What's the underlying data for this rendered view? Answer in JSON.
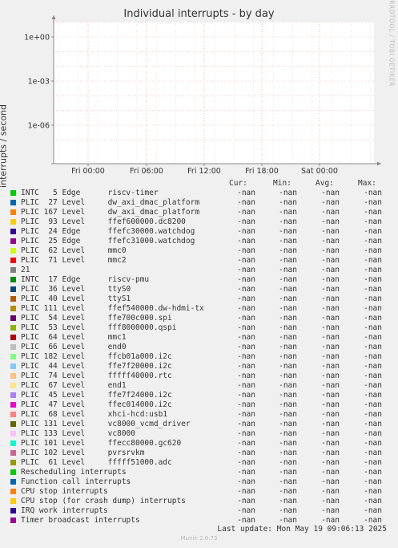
{
  "chart_data": {
    "type": "line",
    "title": "Individual interrupts - by day",
    "ylabel": "interrupts / second",
    "yscale": "log",
    "yticks": [
      "1e+00",
      "1e-03",
      "1e-06"
    ],
    "xticks": [
      "Fri 00:00",
      "Fri 06:00",
      "Fri 12:00",
      "Fri 18:00",
      "Sat 00:00"
    ],
    "grid": true,
    "watermark": "RRDTOOL / TOBI OETIKER",
    "columns": [
      "Cur:",
      "Min:",
      "Avg:",
      "Max:"
    ],
    "series": [
      {
        "name": "INTC   5 Edge      riscv-timer",
        "color": "#00cc00",
        "cur": "-nan",
        "min": "-nan",
        "avg": "-nan",
        "max": "-nan"
      },
      {
        "name": "PLIC  27 Level     dw_axi_dmac_platform",
        "color": "#0066b3",
        "cur": "-nan",
        "min": "-nan",
        "avg": "-nan",
        "max": "-nan"
      },
      {
        "name": "PLIC 167 Level     dw_axi_dmac_platform",
        "color": "#ff8000",
        "cur": "-nan",
        "min": "-nan",
        "avg": "-nan",
        "max": "-nan"
      },
      {
        "name": "PLIC  93 Level     ffef600000.dc8200",
        "color": "#ffcc00",
        "cur": "-nan",
        "min": "-nan",
        "avg": "-nan",
        "max": "-nan"
      },
      {
        "name": "PLIC  24 Edge      ffefc30000.watchdog",
        "color": "#330099",
        "cur": "-nan",
        "min": "-nan",
        "avg": "-nan",
        "max": "-nan"
      },
      {
        "name": "PLIC  25 Edge      ffefc31000.watchdog",
        "color": "#990099",
        "cur": "-nan",
        "min": "-nan",
        "avg": "-nan",
        "max": "-nan"
      },
      {
        "name": "PLIC  62 Level     mmc0",
        "color": "#ccff00",
        "cur": "-nan",
        "min": "-nan",
        "avg": "-nan",
        "max": "-nan"
      },
      {
        "name": "PLIC  71 Level     mmc2",
        "color": "#ff0000",
        "cur": "-nan",
        "min": "-nan",
        "avg": "-nan",
        "max": "-nan"
      },
      {
        "name": "21",
        "color": "#808080",
        "cur": "-nan",
        "min": "-nan",
        "avg": "-nan",
        "max": "-nan"
      },
      {
        "name": "INTC  17 Edge      riscv-pmu",
        "color": "#008f00",
        "cur": "-nan",
        "min": "-nan",
        "avg": "-nan",
        "max": "-nan"
      },
      {
        "name": "PLIC  36 Level     ttyS0",
        "color": "#00487d",
        "cur": "-nan",
        "min": "-nan",
        "avg": "-nan",
        "max": "-nan"
      },
      {
        "name": "PLIC  40 Level     ttyS1",
        "color": "#b35a00",
        "cur": "-nan",
        "min": "-nan",
        "avg": "-nan",
        "max": "-nan"
      },
      {
        "name": "PLIC 111 Level     ffef540000.dw-hdmi-tx",
        "color": "#b38f00",
        "cur": "-nan",
        "min": "-nan",
        "avg": "-nan",
        "max": "-nan"
      },
      {
        "name": "PLIC  54 Level     ffe700c000.spi",
        "color": "#6b006b",
        "cur": "-nan",
        "min": "-nan",
        "avg": "-nan",
        "max": "-nan"
      },
      {
        "name": "PLIC  53 Level     fff8000000.qspi",
        "color": "#8fb300",
        "cur": "-nan",
        "min": "-nan",
        "avg": "-nan",
        "max": "-nan"
      },
      {
        "name": "PLIC  64 Level     mmc1",
        "color": "#b30000",
        "cur": "-nan",
        "min": "-nan",
        "avg": "-nan",
        "max": "-nan"
      },
      {
        "name": "PLIC  66 Level     end0",
        "color": "#bebebe",
        "cur": "-nan",
        "min": "-nan",
        "avg": "-nan",
        "max": "-nan"
      },
      {
        "name": "PLIC 182 Level     ffcb01a000.i2c",
        "color": "#80ff80",
        "cur": "-nan",
        "min": "-nan",
        "avg": "-nan",
        "max": "-nan"
      },
      {
        "name": "PLIC  44 Level     ffe7f20000.i2c",
        "color": "#80c9ff",
        "cur": "-nan",
        "min": "-nan",
        "avg": "-nan",
        "max": "-nan"
      },
      {
        "name": "PLIC  74 Level     fffff40000.rtc",
        "color": "#ffc080",
        "cur": "-nan",
        "min": "-nan",
        "avg": "-nan",
        "max": "-nan"
      },
      {
        "name": "PLIC  67 Level     end1",
        "color": "#ffe680",
        "cur": "-nan",
        "min": "-nan",
        "avg": "-nan",
        "max": "-nan"
      },
      {
        "name": "PLIC  45 Level     ffe7f24000.i2c",
        "color": "#aa80ff",
        "cur": "-nan",
        "min": "-nan",
        "avg": "-nan",
        "max": "-nan"
      },
      {
        "name": "PLIC  47 Level     ffec014000.i2c",
        "color": "#ee00cc",
        "cur": "-nan",
        "min": "-nan",
        "avg": "-nan",
        "max": "-nan"
      },
      {
        "name": "PLIC  68 Level     xhci-hcd:usb1",
        "color": "#ff8080",
        "cur": "-nan",
        "min": "-nan",
        "avg": "-nan",
        "max": "-nan"
      },
      {
        "name": "PLIC 131 Level     vc8000_vcmd_driver",
        "color": "#666600",
        "cur": "-nan",
        "min": "-nan",
        "avg": "-nan",
        "max": "-nan"
      },
      {
        "name": "PLIC 133 Level     vc8000",
        "color": "#ffbfff",
        "cur": "-nan",
        "min": "-nan",
        "avg": "-nan",
        "max": "-nan"
      },
      {
        "name": "PLIC 101 Level     ffecc80000.gc620",
        "color": "#00ffcc",
        "cur": "-nan",
        "min": "-nan",
        "avg": "-nan",
        "max": "-nan"
      },
      {
        "name": "PLIC 102 Level     pvrsrvkm",
        "color": "#cc6699",
        "cur": "-nan",
        "min": "-nan",
        "avg": "-nan",
        "max": "-nan"
      },
      {
        "name": "PLIC  61 Level     fffff51000.adc",
        "color": "#999900",
        "cur": "-nan",
        "min": "-nan",
        "avg": "-nan",
        "max": "-nan"
      },
      {
        "name": "Rescheduling interrupts",
        "color": "#00cc00",
        "cur": "-nan",
        "min": "-nan",
        "avg": "-nan",
        "max": "-nan"
      },
      {
        "name": "Function call interrupts",
        "color": "#0066b3",
        "cur": "-nan",
        "min": "-nan",
        "avg": "-nan",
        "max": "-nan"
      },
      {
        "name": "CPU stop interrupts",
        "color": "#ff8000",
        "cur": "-nan",
        "min": "-nan",
        "avg": "-nan",
        "max": "-nan"
      },
      {
        "name": "CPU stop (for crash dump) interrupts",
        "color": "#ffcc00",
        "cur": "-nan",
        "min": "-nan",
        "avg": "-nan",
        "max": "-nan"
      },
      {
        "name": "IRQ work interrupts",
        "color": "#330099",
        "cur": "-nan",
        "min": "-nan",
        "avg": "-nan",
        "max": "-nan"
      },
      {
        "name": "Timer broadcast interrupts",
        "color": "#990099",
        "cur": "-nan",
        "min": "-nan",
        "avg": "-nan",
        "max": "-nan"
      }
    ]
  },
  "footer": {
    "last_update": "Last update: Mon May 19 09:06:13 2025",
    "munin": "Munin 2.0.73"
  }
}
